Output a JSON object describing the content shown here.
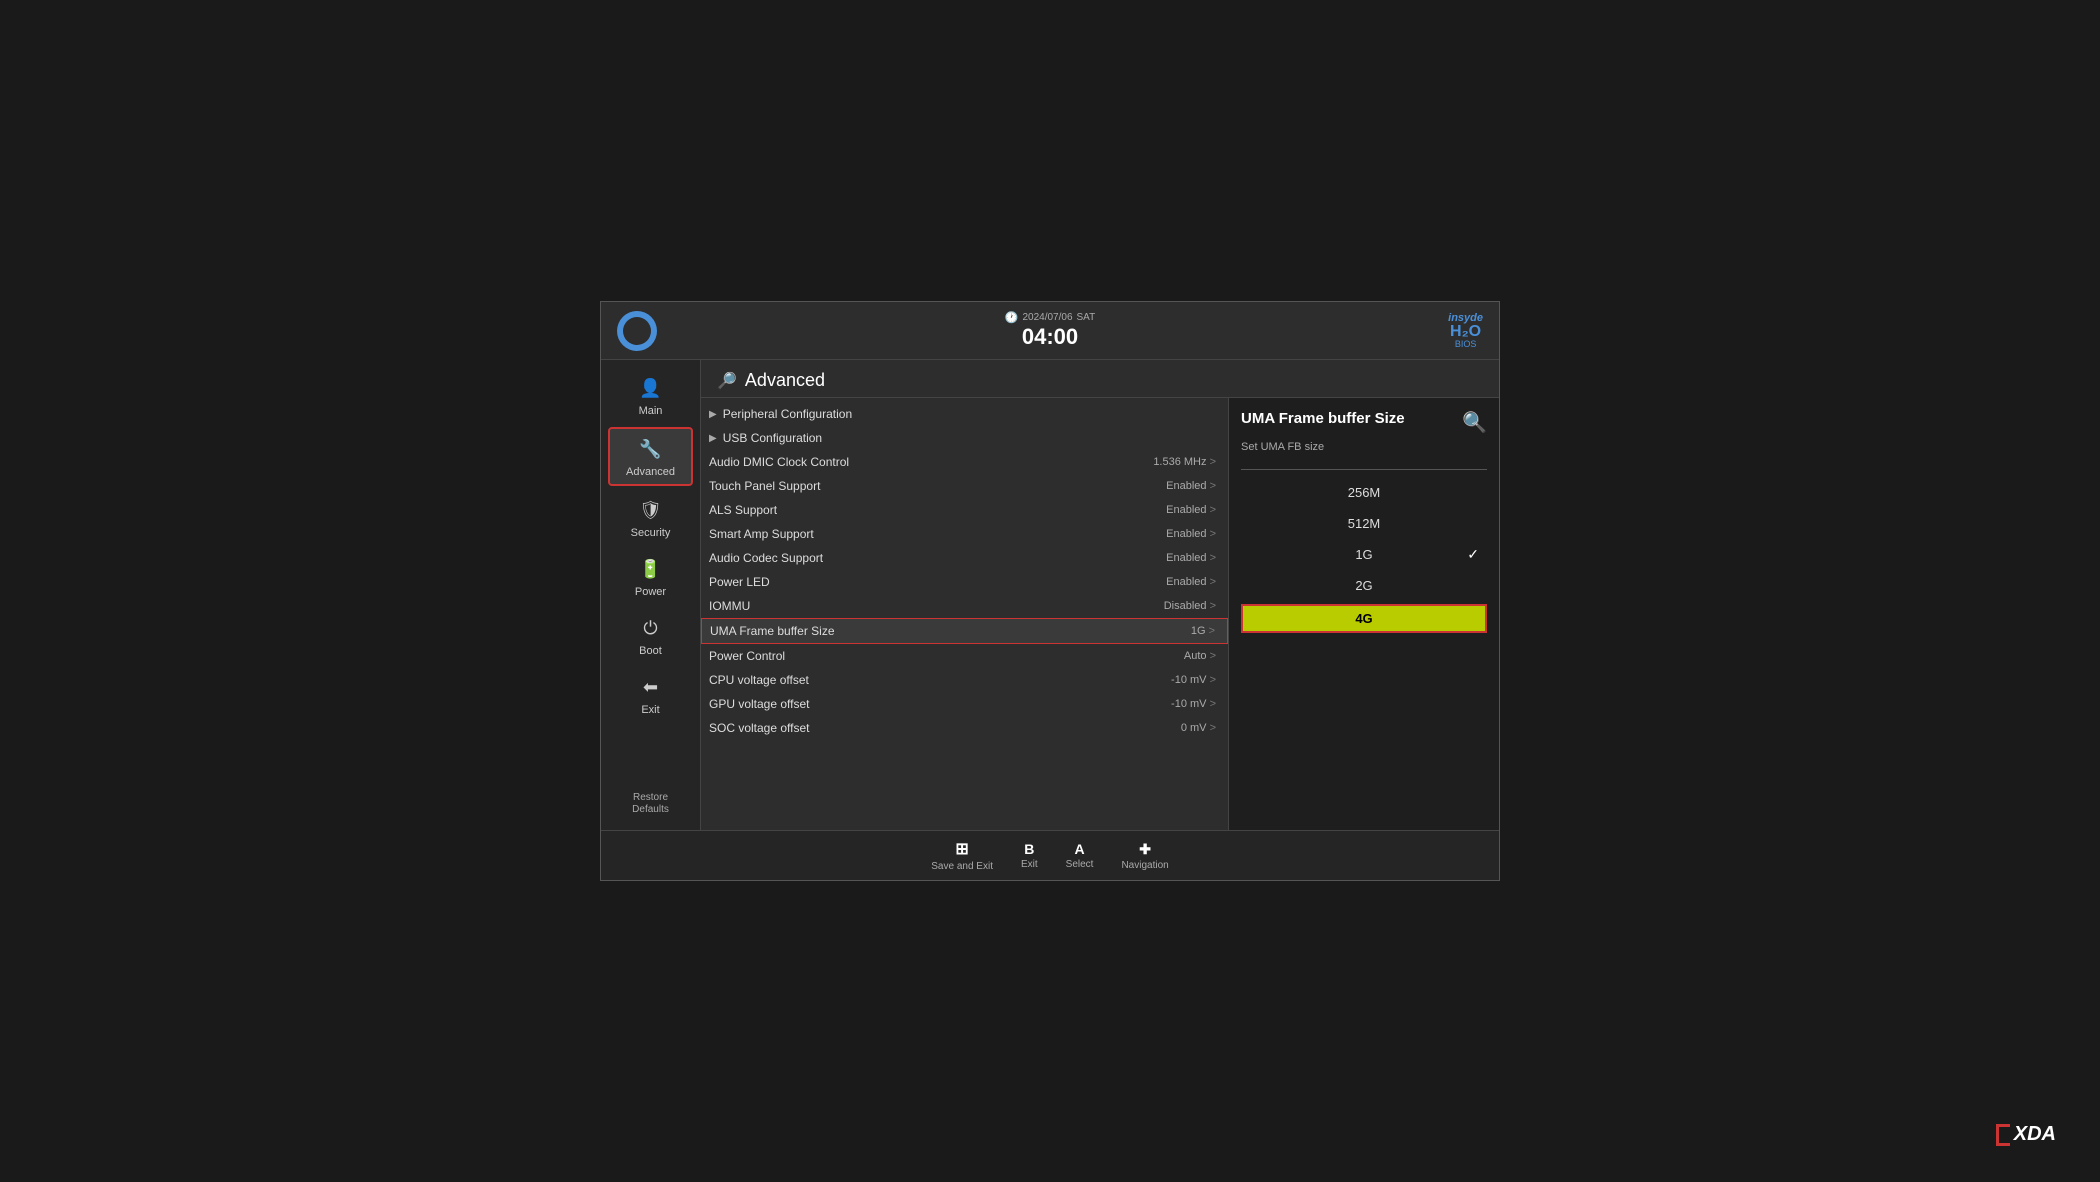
{
  "header": {
    "date": "2024/07/06",
    "day": "SAT",
    "time": "04:00",
    "logo": "insyde H₂O BIOS"
  },
  "sidebar": {
    "items": [
      {
        "id": "main",
        "label": "Main",
        "icon": "👤"
      },
      {
        "id": "advanced",
        "label": "Advanced",
        "icon": "🔧",
        "active": true
      },
      {
        "id": "security",
        "label": "Security",
        "icon": "🛡"
      },
      {
        "id": "power",
        "label": "Power",
        "icon": "🔋"
      },
      {
        "id": "boot",
        "label": "Boot",
        "icon": "⏻"
      },
      {
        "id": "exit",
        "label": "Exit",
        "icon": "⬅"
      }
    ],
    "restore_defaults": "Restore\nDefaults"
  },
  "section": {
    "title": "Advanced",
    "icon": "🔎"
  },
  "menu": {
    "items": [
      {
        "name": "Peripheral Configuration",
        "value": "",
        "arrow": true
      },
      {
        "name": "USB Configuration",
        "value": "",
        "arrow": true
      },
      {
        "name": "Audio DMIC Clock Control",
        "value": "1.536 MHz",
        "arrow": false
      },
      {
        "name": "Touch Panel Support",
        "value": "Enabled",
        "arrow": false
      },
      {
        "name": "ALS Support",
        "value": "Enabled",
        "arrow": false
      },
      {
        "name": "Smart Amp Support",
        "value": "Enabled",
        "arrow": false
      },
      {
        "name": "Audio Codec Support",
        "value": "Enabled",
        "arrow": false
      },
      {
        "name": "Power LED",
        "value": "Enabled",
        "arrow": false
      },
      {
        "name": "IOMMU",
        "value": "Disabled",
        "arrow": false
      },
      {
        "name": "UMA Frame buffer Size",
        "value": "1G",
        "arrow": false,
        "highlighted": true
      },
      {
        "name": "Power Control",
        "value": "Auto",
        "arrow": false
      },
      {
        "name": "CPU voltage offset",
        "value": "-10 mV",
        "arrow": false
      },
      {
        "name": "GPU voltage offset",
        "value": "-10 mV",
        "arrow": false
      },
      {
        "name": "SOC voltage offset",
        "value": "0 mV",
        "arrow": false
      }
    ]
  },
  "right_panel": {
    "title": "UMA Frame buffer Size",
    "subtitle": "Set UMA FB size",
    "icon": "🔍",
    "options": [
      {
        "label": "256M",
        "selected": false,
        "checked": false
      },
      {
        "label": "512M",
        "selected": false,
        "checked": false
      },
      {
        "label": "1G",
        "selected": false,
        "checked": true
      },
      {
        "label": "2G",
        "selected": false,
        "checked": false
      },
      {
        "label": "4G",
        "selected": true,
        "checked": false
      }
    ]
  },
  "footer": {
    "items": [
      {
        "key": "⊞",
        "label": "Save and Exit",
        "type": "icon"
      },
      {
        "key": "B",
        "label": "Exit",
        "type": "text"
      },
      {
        "key": "A",
        "label": "Select",
        "type": "text"
      },
      {
        "key": "✚",
        "label": "Navigation",
        "type": "symbol"
      }
    ]
  },
  "insyde": {
    "line1": "insyde",
    "line2": "H₂O",
    "line3": "BIOS"
  }
}
